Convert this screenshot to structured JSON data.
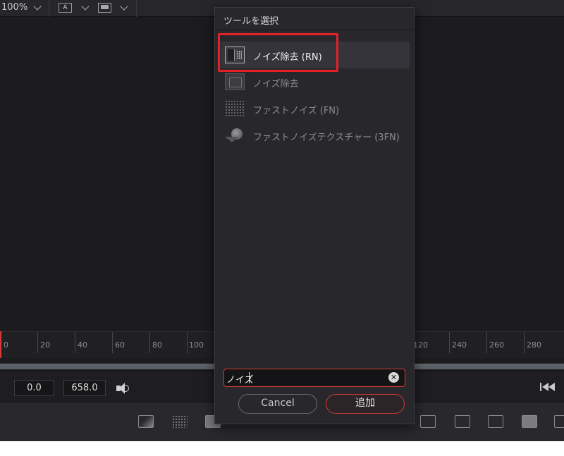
{
  "topbar": {
    "zoom": "100%",
    "viewer_mode_label": "A"
  },
  "ruler": {
    "ticks": [
      "0",
      "20",
      "40",
      "60",
      "80",
      "100",
      "120",
      "240",
      "260",
      "280"
    ],
    "partial_tick": "0"
  },
  "transport": {
    "in_time": "0.0",
    "out_time": "658.0"
  },
  "dialog": {
    "title": "ツールを選択",
    "items": [
      {
        "label": "ノイズ除去 (RN)",
        "icon": "noise-reduction-rn-icon",
        "selected": true
      },
      {
        "label": "ノイズ除去",
        "icon": "noise-reduction-icon",
        "selected": false
      },
      {
        "label": "ファストノイズ (FN)",
        "icon": "fast-noise-icon",
        "selected": false
      },
      {
        "label": "ファストノイズテクスチャー (3FN)",
        "icon": "fast-noise-texture-icon",
        "selected": false
      }
    ],
    "search": {
      "value": "ノイズ",
      "clear_icon": "clear-icon"
    },
    "cancel_label": "Cancel",
    "add_label": "追加"
  },
  "colors": {
    "accent_red": "#d23a34",
    "highlight_red": "#e52128",
    "background": "#1c1c1f",
    "dialog_bg": "#28282c"
  }
}
